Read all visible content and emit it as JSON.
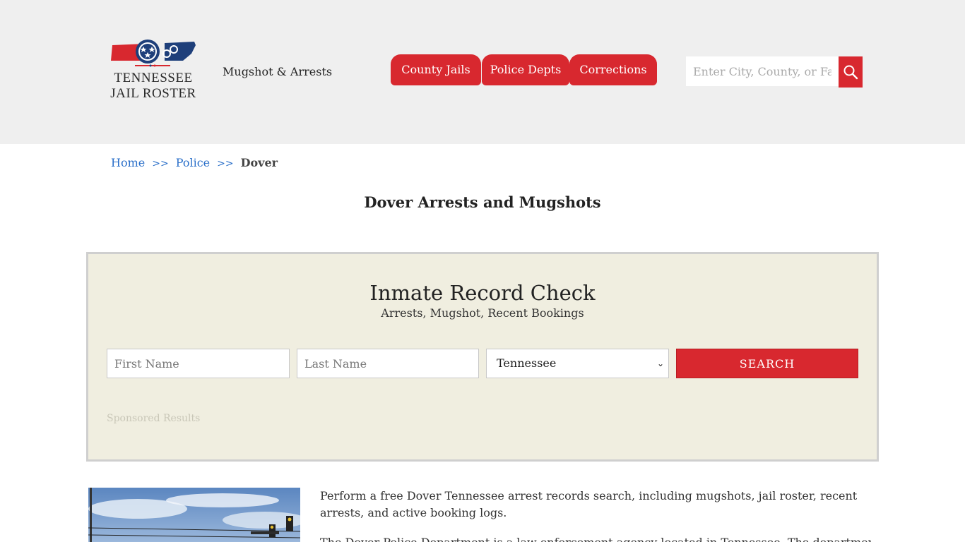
{
  "header": {
    "logo": {
      "line1": "TENNESSEE",
      "line2": "JAIL ROSTER"
    },
    "tagline": "Mugshot & Arrests",
    "tabs": [
      {
        "label": "County Jails"
      },
      {
        "label": "Police Depts"
      },
      {
        "label": "Corrections"
      }
    ],
    "search": {
      "placeholder": "Enter City, County, or Facility",
      "value": ""
    }
  },
  "breadcrumb": {
    "home": "Home",
    "sep1": ">>",
    "police": "Police",
    "sep2": ">>",
    "current": "Dover"
  },
  "page_title": "Dover Arrests and Mugshots",
  "record_check": {
    "title": "Inmate Record Check",
    "subtitle": "Arrests, Mugshot, Recent Bookings",
    "first_name_placeholder": "First Name",
    "last_name_placeholder": "Last Name",
    "state_selected": "Tennessee",
    "search_label": "SEARCH",
    "sponsored": "Sponsored Results"
  },
  "content": {
    "para1": "Perform a free Dover Tennessee arrest records search, including mugshots, jail roster, recent arrests, and active booking logs.",
    "para2": "The Dover Police Department is a law enforcement agency located in Tennessee. The department is"
  },
  "colors": {
    "brand_red": "#d8282f",
    "header_bg": "#efefef",
    "panel_bg": "#f0eee0",
    "link_blue": "#2a6fc9"
  }
}
